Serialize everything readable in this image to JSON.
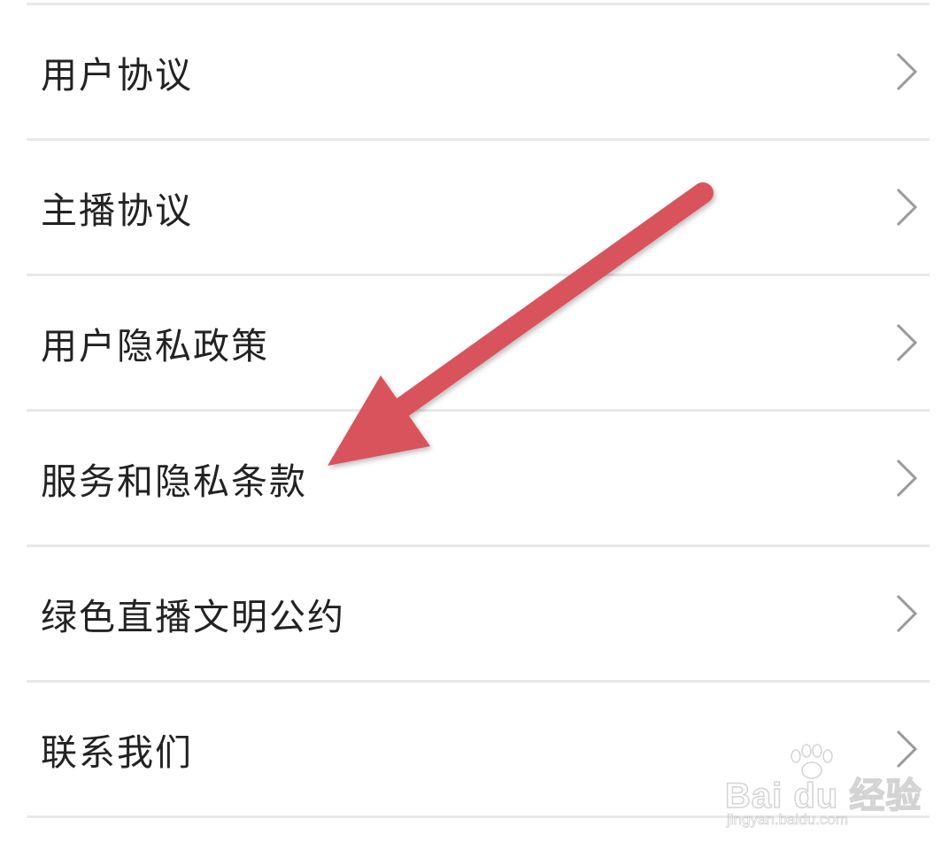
{
  "menu": {
    "items": [
      {
        "label": "用户协议"
      },
      {
        "label": "主播协议"
      },
      {
        "label": "用户隐私政策"
      },
      {
        "label": "服务和隐私条款"
      },
      {
        "label": "绿色直播文明公约"
      },
      {
        "label": "联系我们"
      }
    ]
  },
  "annotation": {
    "arrow_color": "#d9535b",
    "arrow_target": "服务和隐私条款"
  },
  "watermark": {
    "brand": "Bai du 经验",
    "url": "jingyan.baidu.com"
  },
  "colors": {
    "text": "#222222",
    "divider": "#e8e8e8",
    "chevron": "#9a9a9a",
    "background": "#ffffff"
  },
  "icons": {
    "row_chevron": "chevron-right-icon",
    "watermark_logo": "paw-icon"
  }
}
